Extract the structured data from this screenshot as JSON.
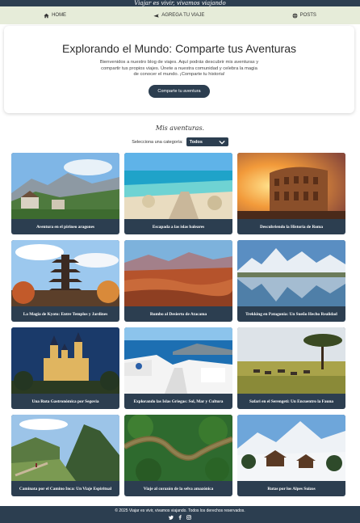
{
  "site": {
    "tagline": "Viajar es vivir, vivamos viajando"
  },
  "nav": [
    {
      "label": "HOME",
      "icon": "home-icon"
    },
    {
      "label": "AGREGA TU VIAJE",
      "icon": "plane-icon"
    },
    {
      "label": "POSTS",
      "icon": "globe-icon"
    }
  ],
  "hero": {
    "title": "Explorando el Mundo: Comparte tus Aventuras",
    "text": "Bienvenidos a nuestro blog de viajes. Aquí podrás descubrir mis aventuras y compartir tus propios viajes. Únete a nuestra comunidad y celebra la magia de conocer el mundo. ¡Comparte tu historia!",
    "cta": "Comparte tu aventura"
  },
  "adventures": {
    "title": "Mis aventuras.",
    "category_label": "Selecciona una categoría:",
    "category_value": "Todos"
  },
  "cards": [
    {
      "caption": "Aventura en el pirineo aragones"
    },
    {
      "caption": "Escapada a las islas baleares"
    },
    {
      "caption": "Descubriendo la Historia de Roma"
    },
    {
      "caption": "La Magia de Kyoto: Entre Templos y Jardines"
    },
    {
      "caption": "Rumbo al Desierto de Atacama"
    },
    {
      "caption": "Trekking en Patagonia: Un Sueño Hecho Realidad"
    },
    {
      "caption": "Una Ruta Gastronómica por Segovia"
    },
    {
      "caption": "Explorando las Islas Griegas: Sol, Mar y Cultura"
    },
    {
      "caption": "Safari en el Serengeti: Un Encuentro la Fauna"
    },
    {
      "caption": "Caminata por el Camino Inca: Un Viaje Espiritual"
    },
    {
      "caption": "Viaje al corazón de la selva amazónica"
    },
    {
      "caption": "Rutas por los Alpes Suizos"
    }
  ],
  "footer": {
    "copyright": "© 2025 Viajar es vivir, vivamos viajando. Todos los derechos reservados.",
    "social": [
      "twitter-icon",
      "facebook-icon",
      "instagram-icon"
    ]
  },
  "colors": {
    "dark": "#2c3e50",
    "nav_bg": "#e6ecd9"
  }
}
